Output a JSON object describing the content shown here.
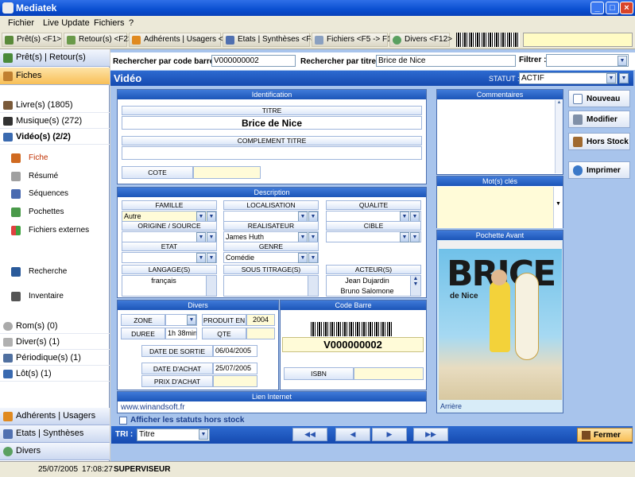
{
  "window": {
    "title": "Mediatek"
  },
  "menu": [
    "Fichier",
    "Live Update",
    "Fichiers",
    "?"
  ],
  "toolbar": {
    "pret": "Prêt(s) <F1>",
    "retour": "Retour(s) <F2>",
    "adherents": "Adhérents | Usagers <F3>",
    "etats": "Etats | Synthèses <F4>",
    "fichiers": "Fichiers <F5 -> F11>",
    "divers": "Divers <F12>"
  },
  "sidebar": {
    "pret_retour": "Prêt(s) | Retour(s)",
    "fiches": "Fiches",
    "livres": "Livre(s) (1805)",
    "musique": "Musique(s) (272)",
    "video": "Vidéo(s) (2/2)",
    "sub": {
      "fiche": "Fiche",
      "resume": "Résumé",
      "sequences": "Séquences",
      "pochettes": "Pochettes",
      "fichiers_externes": "Fichiers externes",
      "recherche": "Recherche",
      "inventaire": "Inventaire"
    },
    "roms": "Rom(s) (0)",
    "divers": "Diver(s) (1)",
    "periodiques": "Périodique(s) (1)",
    "lots": "Lôt(s) (1)",
    "adherents": "Adhérents | Usagers",
    "etats": "Etats | Synthèses",
    "divers_bottom": "Divers"
  },
  "search": {
    "barcode_label": "Rechercher par code barre :",
    "barcode_value": "V000000002",
    "title_label": "Rechercher par titre :",
    "title_value": "Brice de Nice",
    "filter_label": "Filtrer :"
  },
  "section": {
    "title": "Vidéo",
    "statut_label": "STATUT :",
    "statut_value": "ACTIF"
  },
  "identification": {
    "header": "Identification",
    "titre_label": "TITRE",
    "titre": "Brice de Nice",
    "complement_label": "COMPLEMENT TITRE",
    "cote_label": "COTE"
  },
  "description": {
    "header": "Description",
    "famille_label": "FAMILLE",
    "famille": "Autre",
    "localisation_label": "LOCALISATION",
    "qualite_label": "QUALITE",
    "origine_label": "ORIGINE / SOURCE",
    "realisateur_label": "REALISATEUR",
    "realisateur": "James Huth",
    "cible_label": "CIBLE",
    "etat_label": "ETAT",
    "genre_label": "GENRE",
    "genre": "Comédie",
    "langages_label": "LANGAGE(S)",
    "langage": "français",
    "sous_titrage_label": "SOUS TITRAGE(S)",
    "acteurs_label": "ACTEUR(S)",
    "acteurs": [
      "Jean Dujardin",
      "Bruno Salomone"
    ]
  },
  "divers": {
    "header": "Divers",
    "zone_label": "ZONE",
    "produit_label": "PRODUIT EN",
    "produit": "2004",
    "duree_label": "DUREE",
    "duree": "1h 38min",
    "qte_label": "QTE",
    "sortie_label": "DATE DE SORTIE",
    "sortie": "06/04/2005",
    "achat_label": "DATE D'ACHAT",
    "achat": "25/07/2005",
    "prix_label": "PRIX D'ACHAT"
  },
  "codebarre": {
    "header": "Code Barre",
    "value": "V000000002",
    "isbn_label": "ISBN"
  },
  "lien": {
    "header": "Lien Internet",
    "url": "www.winandsoft.fr"
  },
  "commentaires": {
    "header": "Commentaires"
  },
  "motscles": {
    "header": "Mot(s) clés"
  },
  "pochette": {
    "header": "Pochette Avant",
    "title": "BRICE",
    "subtitle": "de Nice",
    "arriere": "Arrière"
  },
  "actions": {
    "nouveau": "Nouveau",
    "modifier": "Modifier",
    "hors_stock": "Hors Stock",
    "imprimer": "Imprimer"
  },
  "footer": {
    "afficher": "Afficher les statuts hors stock",
    "tri_label": "TRI :",
    "tri_value": "Titre",
    "fermer": "Fermer"
  },
  "status": {
    "date": "25/07/2005",
    "time": "17:08:27",
    "user": "SUPERVISEUR"
  }
}
